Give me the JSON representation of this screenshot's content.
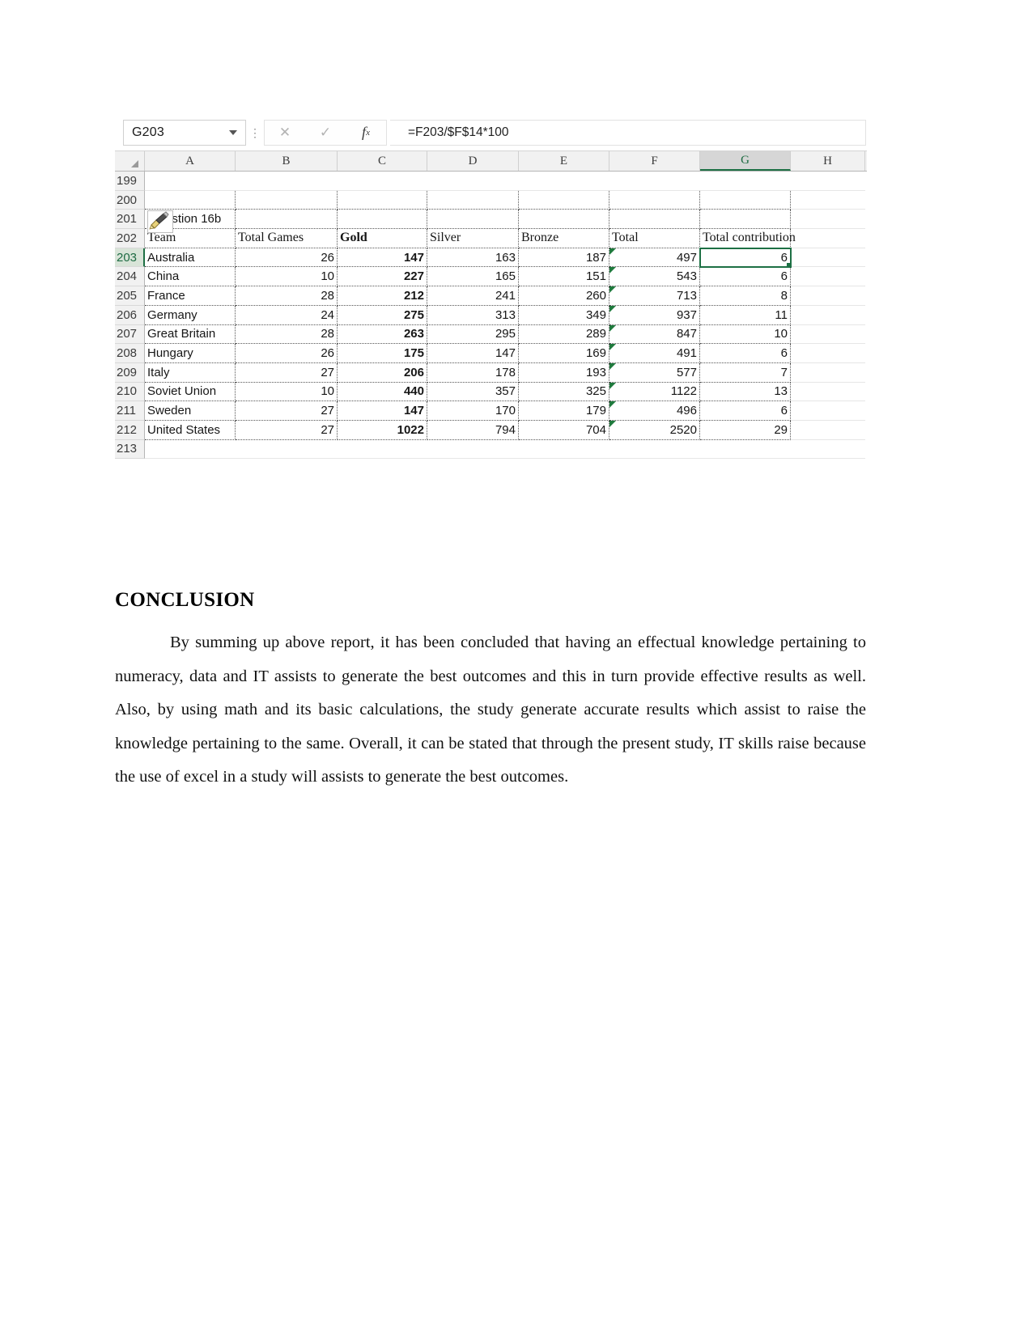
{
  "spreadsheet": {
    "name_box": "G203",
    "formula": "=F203/$F$14*100",
    "icons": {
      "dropdown": "chevron-down-icon",
      "cancel": "cancel-icon",
      "enter": "confirm-check-icon",
      "insert_function": "fx-icon",
      "select_all": "select-all-corner-icon",
      "format_painter": "format-painter-icon"
    },
    "cancel_glyph": "✕",
    "check_glyph": "✓",
    "fx_glyph": "fx",
    "column_headers": [
      "A",
      "B",
      "C",
      "D",
      "E",
      "F",
      "G",
      "H"
    ],
    "selected_column": "G",
    "selected_row": "203",
    "selected_cell": "G203",
    "row_numbers": [
      "199",
      "200",
      "201",
      "202",
      "203",
      "204",
      "205",
      "206",
      "207",
      "208",
      "209",
      "210",
      "211",
      "212",
      "213"
    ],
    "note_row": {
      "row": "201",
      "text": "estion 16b"
    },
    "table_headers": [
      "Team",
      "Total Games",
      "Gold",
      "Silver",
      "Bronze",
      "Total",
      "Total contribution"
    ],
    "rows": [
      {
        "row": "203",
        "team": "Australia",
        "total_games": "26",
        "gold": "147",
        "silver": "163",
        "bronze": "187",
        "total": "497",
        "contribution": "6"
      },
      {
        "row": "204",
        "team": "China",
        "total_games": "10",
        "gold": "227",
        "silver": "165",
        "bronze": "151",
        "total": "543",
        "contribution": "6"
      },
      {
        "row": "205",
        "team": "France",
        "total_games": "28",
        "gold": "212",
        "silver": "241",
        "bronze": "260",
        "total": "713",
        "contribution": "8"
      },
      {
        "row": "206",
        "team": "Germany",
        "total_games": "24",
        "gold": "275",
        "silver": "313",
        "bronze": "349",
        "total": "937",
        "contribution": "11"
      },
      {
        "row": "207",
        "team": "Great Britain",
        "total_games": "28",
        "gold": "263",
        "silver": "295",
        "bronze": "289",
        "total": "847",
        "contribution": "10"
      },
      {
        "row": "208",
        "team": "Hungary",
        "total_games": "26",
        "gold": "175",
        "silver": "147",
        "bronze": "169",
        "total": "491",
        "contribution": "6"
      },
      {
        "row": "209",
        "team": "Italy",
        "total_games": "27",
        "gold": "206",
        "silver": "178",
        "bronze": "193",
        "total": "577",
        "contribution": "7"
      },
      {
        "row": "210",
        "team": "Soviet Union",
        "total_games": "10",
        "gold": "440",
        "silver": "357",
        "bronze": "325",
        "total": "1122",
        "contribution": "13"
      },
      {
        "row": "211",
        "team": "Sweden",
        "total_games": "27",
        "gold": "147",
        "silver": "170",
        "bronze": "179",
        "total": "496",
        "contribution": "6"
      },
      {
        "row": "212",
        "team": "United States",
        "total_games": "27",
        "gold": "1022",
        "silver": "794",
        "bronze": "704",
        "total": "2520",
        "contribution": "29"
      }
    ],
    "colors": {
      "selection_green": "#1d7044",
      "error_triangle_green": "#1f7a3d",
      "header_gray": "#f1f1f1"
    }
  },
  "document": {
    "heading": "CONCLUSION",
    "paragraph": "By summing up above report, it has been concluded that having an effectual knowledge pertaining to numeracy, data and IT assists to generate the best outcomes and this in turn provide effective results as well. Also, by using math and its basic calculations, the study generate accurate results which assist to raise the knowledge pertaining to the same. Overall, it can be stated that through the present study, IT skills raise because the use of excel in a study will assists to generate the best outcomes."
  }
}
